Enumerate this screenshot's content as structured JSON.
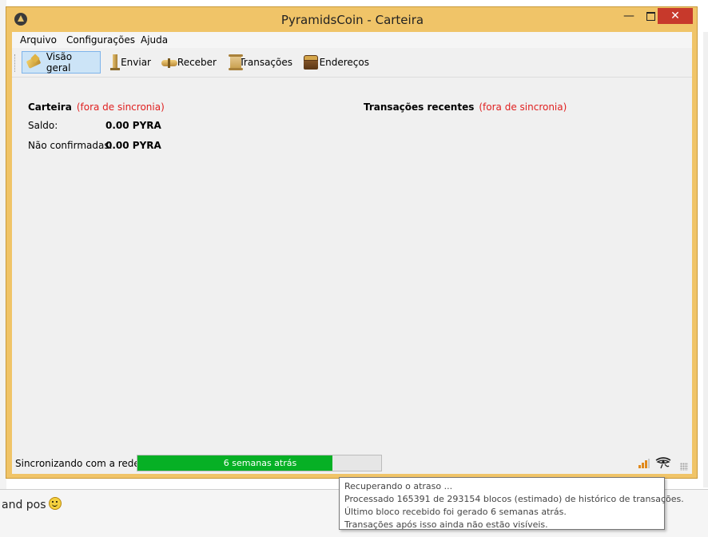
{
  "window": {
    "title": "PyramidsCoin - Carteira",
    "minimize": "—",
    "close": "✕"
  },
  "menu": [
    "Arquivo",
    "Configurações",
    "Ajuda"
  ],
  "toolbar": {
    "overview": "Visão geral",
    "send": "Enviar",
    "receive": "Receber",
    "transactions": "Transações",
    "addresses": "Endereços"
  },
  "wallet": {
    "title": "Carteira",
    "sync_status": "(fora de sincronia)",
    "balance_label": "Saldo:",
    "balance_value": "0.00 PYRA",
    "unconfirmed_label": "Não confirmadas:",
    "unconfirmed_value": "0.00 PYRA"
  },
  "recent": {
    "title": "Transações recentes",
    "sync_status": "(fora de sincronia)"
  },
  "status": {
    "text": "Sincronizando com a rede...",
    "progress_text": "6 semanas atrás",
    "progress_fraction": 0.8,
    "progress_color": "#06b025"
  },
  "tooltip": {
    "lines": [
      "Recuperando o atraso ...",
      "Processado 165391 de 293154 blocos (estimado) de histórico de transações.",
      "Último bloco recebido foi gerado 6 semanas atrás.",
      "Transações após isso ainda não estão visíveis."
    ]
  },
  "background": {
    "bottom_text": "and pos"
  },
  "colors": {
    "frame": "#f0c468",
    "out_of_sync": "#e02020",
    "close_button": "#c7392b",
    "active_tool": "#cce4f7"
  }
}
